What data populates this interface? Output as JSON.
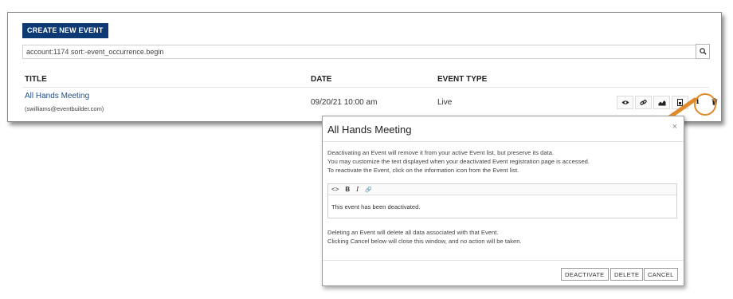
{
  "toolbar": {
    "create_label": "CREATE NEW EVENT"
  },
  "search": {
    "value": "account:1174 sort:-event_occurrence.begin",
    "button_icon": "search-icon"
  },
  "table": {
    "headers": {
      "title": "TITLE",
      "date": "DATE",
      "type": "EVENT TYPE"
    },
    "rows": [
      {
        "title": "All Hands Meeting",
        "email": "(swilliams@eventbuilder.com)",
        "date": "09/20/21 10:00 am",
        "type": "Live",
        "actions": [
          "eye-icon",
          "link-icon",
          "chart-icon",
          "document-icon",
          "info-icon",
          "trash-icon"
        ]
      }
    ]
  },
  "modal": {
    "title": "All Hands Meeting",
    "close": "×",
    "intro_lines": [
      "Deactivating an Event will remove it from your active Event list, but preserve its data.",
      "You may customize the text displayed when your deactivated Event registration page is accessed.",
      "To reactivate the Event, click on the information icon from the Event list."
    ],
    "editor": {
      "tools": {
        "code": "<>",
        "bold": "B",
        "italic": "I",
        "link": "🔗"
      },
      "content": "This event has been deactivated."
    },
    "delete_lines": [
      "Deleting an Event will delete all data associated with that Event.",
      "Clicking Cancel below will close this window, and no action will be taken."
    ],
    "buttons": {
      "deactivate": "DEACTIVATE",
      "delete": "DELETE",
      "cancel": "CANCEL"
    }
  },
  "colors": {
    "brand": "#0d3a74",
    "link": "#1f4f8a",
    "highlight": "#e08a2c"
  }
}
